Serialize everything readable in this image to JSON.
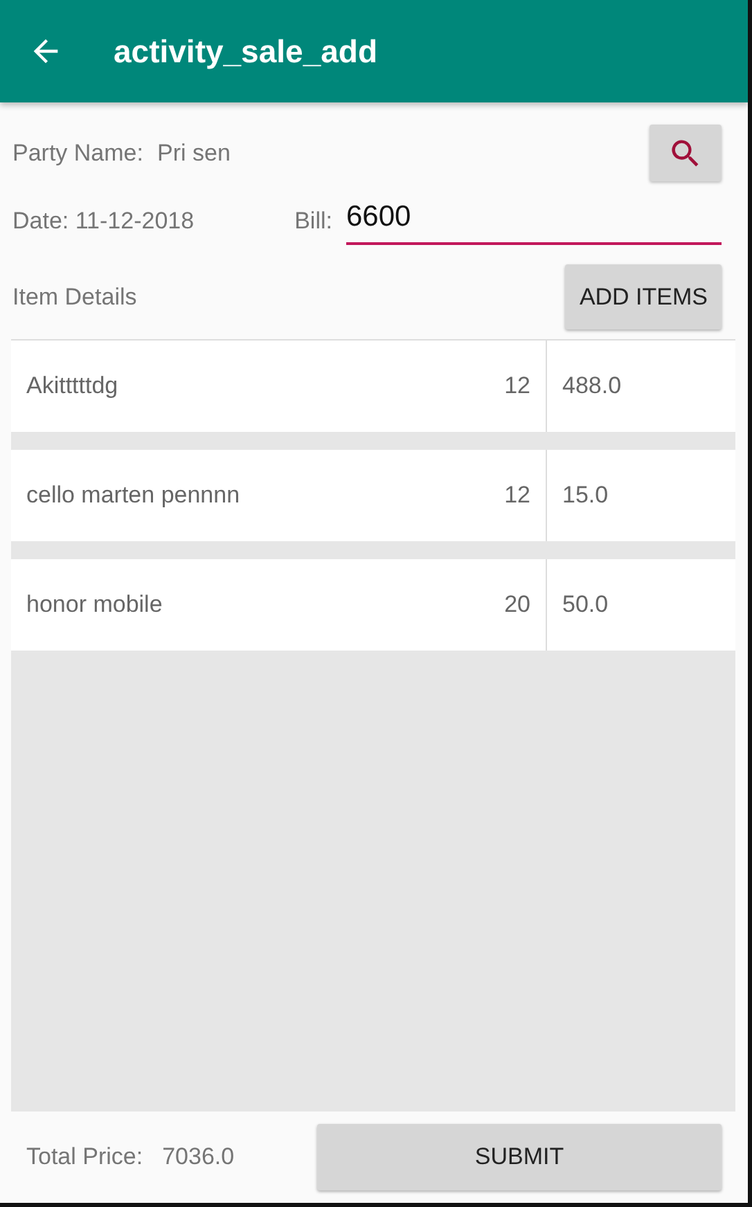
{
  "app_bar": {
    "title": "activity_sale_add"
  },
  "party": {
    "label": "Party Name:",
    "value": "Pri sen"
  },
  "date": {
    "label": "Date: 11-12-2018"
  },
  "bill": {
    "label": "Bill:",
    "value": "6600"
  },
  "items_header": {
    "label": "Item Details",
    "button": "ADD ITEMS"
  },
  "items": [
    {
      "name": "Akitttttdg",
      "qty": "12",
      "price": "488.0"
    },
    {
      "name": "cello marten pennnn",
      "qty": "12",
      "price": "15.0"
    },
    {
      "name": "honor mobile",
      "qty": "20",
      "price": "50.0"
    }
  ],
  "footer": {
    "label": "Total Price:",
    "value": "7036.0",
    "button": "SUBMIT"
  }
}
